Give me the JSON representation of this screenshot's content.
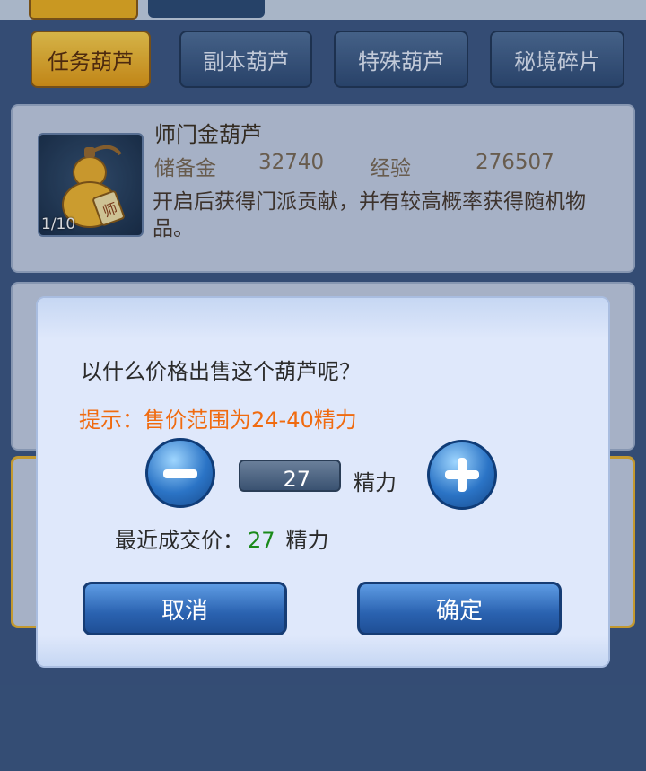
{
  "tabs": [
    {
      "label": "任务葫芦",
      "active": true
    },
    {
      "label": "副本葫芦",
      "active": false
    },
    {
      "label": "特殊葫芦",
      "active": false
    },
    {
      "label": "秘境碎片",
      "active": false
    }
  ],
  "item": {
    "name": "师门金葫芦",
    "count": "1/10",
    "stat1_label": "储备金",
    "stat1_value": "32740",
    "stat2_label": "经验",
    "stat2_value": "276507",
    "description": "开启后获得门派贡献，并有较高概率获得随机物品。",
    "icon": "gourd-icon"
  },
  "dialog": {
    "question": "以什么价格出售这个葫芦呢？",
    "hint": "提示：售价范围为24-40精力",
    "value": "27",
    "unit": "精力",
    "recent_label": "最近成交价：",
    "recent_price": "27",
    "recent_unit": "精力",
    "cancel_label": "取消",
    "confirm_label": "确定"
  },
  "colors": {
    "hint": "#f06b10",
    "recent_price": "#1a8a1a",
    "tab_active": "#f1b31d"
  }
}
